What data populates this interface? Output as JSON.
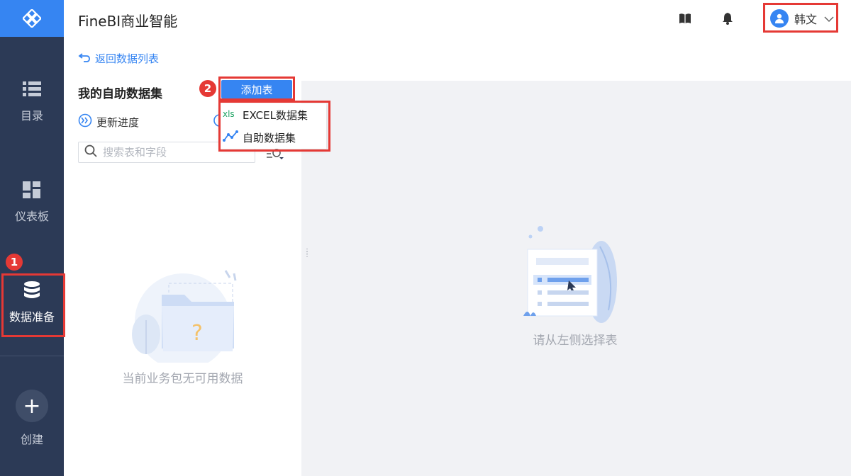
{
  "sidebar": {
    "items": [
      {
        "label": "目录",
        "icon": "list-icon"
      },
      {
        "label": "仪表板",
        "icon": "dashboard-icon"
      },
      {
        "label": "数据准备",
        "icon": "database-icon",
        "active": true
      }
    ],
    "create_label": "创建"
  },
  "header": {
    "title": "FineBI商业智能",
    "user_name": "韩文"
  },
  "panel": {
    "back_label": "返回数据列表",
    "title": "我的自助数据集",
    "update_label": "更新进度",
    "search_placeholder": "搜索表和字段",
    "empty_text": "当前业务包无可用数据"
  },
  "add_button": {
    "label": "添加表",
    "menu": [
      {
        "label": "EXCEL数据集",
        "icon": "xls-icon"
      },
      {
        "label": "自助数据集",
        "icon": "self-service-dataset-icon"
      }
    ]
  },
  "main": {
    "empty_text": "请从左侧选择表"
  },
  "annotations": [
    "1",
    "2"
  ],
  "colors": {
    "sidebar_bg": "#2c3a56",
    "accent": "#3685f2",
    "highlight": "#e53935"
  }
}
